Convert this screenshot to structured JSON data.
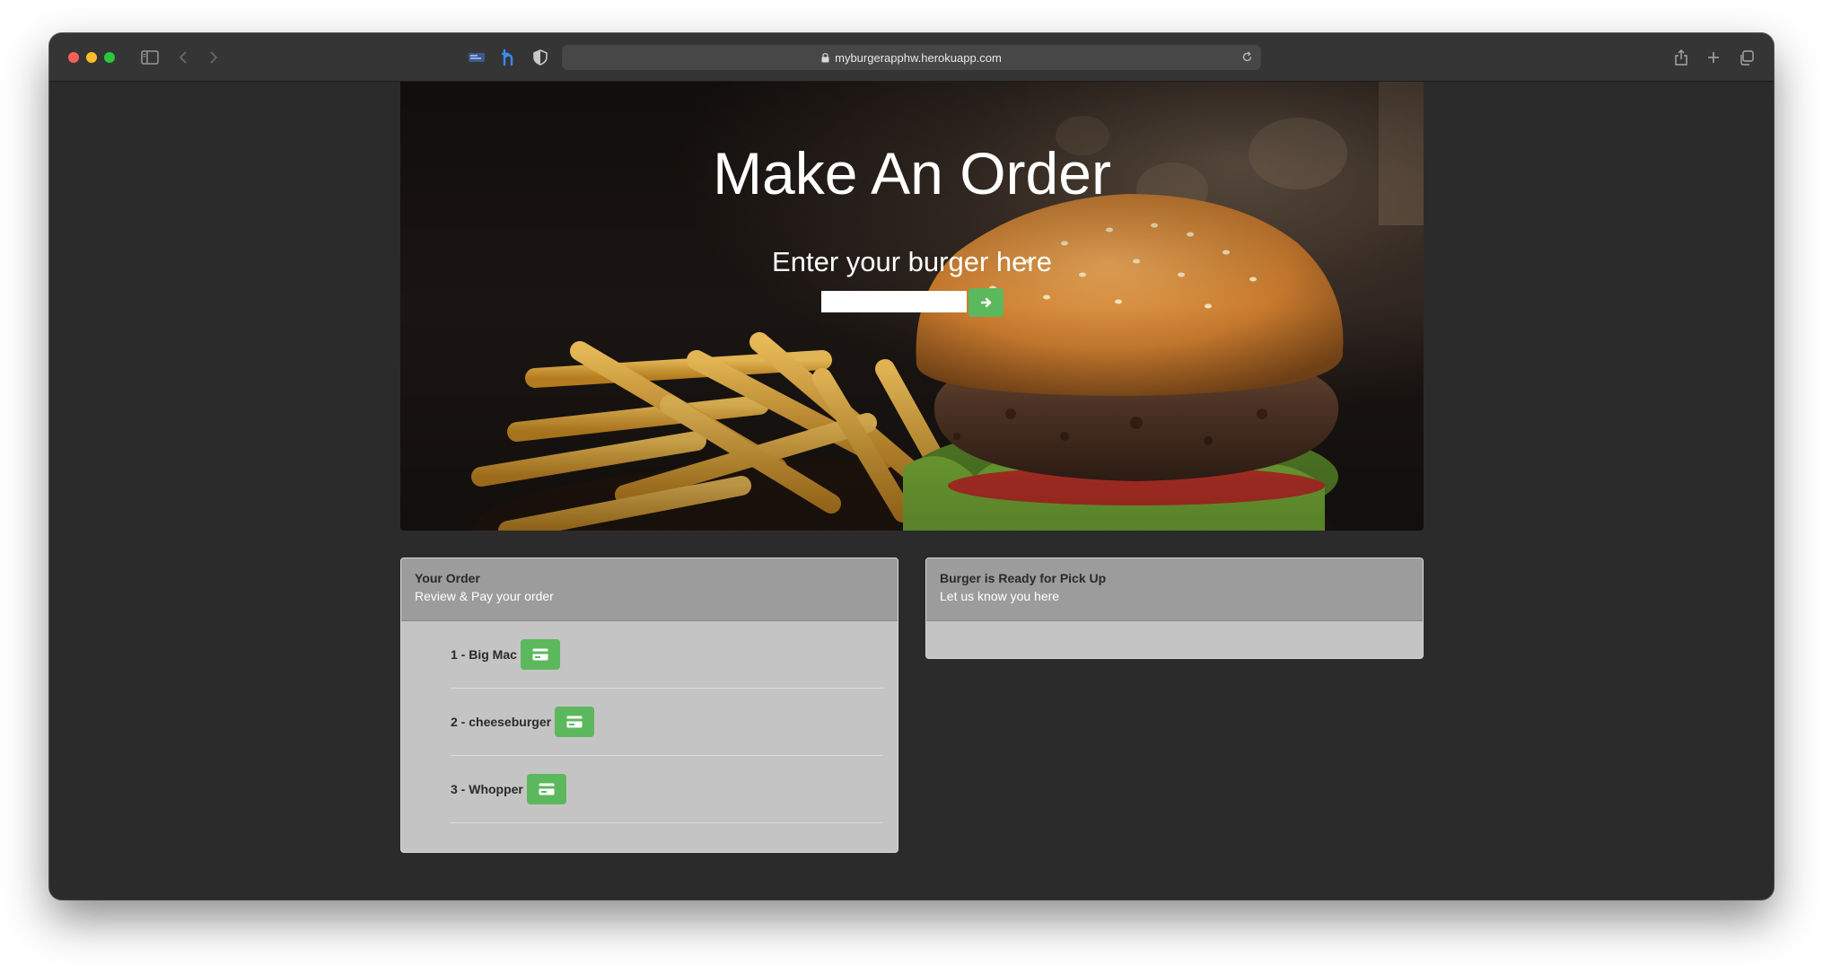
{
  "browser": {
    "url": "myburgerapphw.herokuapp.com"
  },
  "hero": {
    "title": "Make An Order",
    "subtitle": "Enter your burger here",
    "input_value": "",
    "submit_icon": "arrow-right-icon"
  },
  "orders_panel": {
    "title": "Your Order",
    "subtitle": "Review & Pay your order",
    "items": [
      {
        "label": "1 - Big Mac",
        "icon": "credit-card-icon"
      },
      {
        "label": "2 - cheeseburger",
        "icon": "credit-card-icon"
      },
      {
        "label": "3 - Whopper",
        "icon": "credit-card-icon"
      }
    ]
  },
  "pickup_panel": {
    "title": "Burger is Ready for Pick Up",
    "subtitle": "Let us know you here"
  },
  "colors": {
    "accent_green": "#5cb85c",
    "page_background": "#2b2b2b",
    "panel_header": "#9c9c9c",
    "panel_body": "#c4c4c4"
  }
}
